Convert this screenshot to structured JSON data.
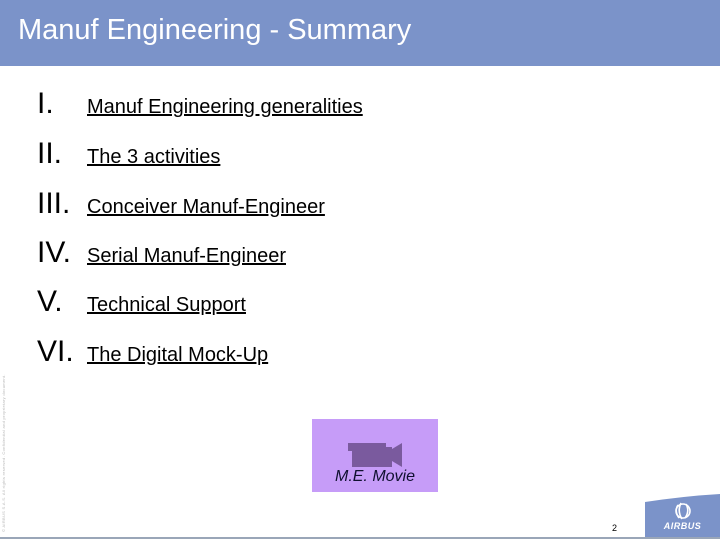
{
  "header": {
    "title": "Manuf Engineering - Summary",
    "background_color": "#7b93c9"
  },
  "copyright_notice": "© AIRBUS S.A.S. All rights reserved. Confidential and proprietary document.",
  "agenda": {
    "items": [
      {
        "numeral": "I.",
        "label": "Manuf Engineering generalities"
      },
      {
        "numeral": "II.",
        "label": "The 3 activities"
      },
      {
        "numeral": "III.",
        "label": "Conceiver Manuf-Engineer"
      },
      {
        "numeral": "IV.",
        "label": "Serial Manuf-Engineer"
      },
      {
        "numeral": "V.",
        "label": "Technical Support"
      },
      {
        "numeral": "VI.",
        "label": "The Digital Mock-Up"
      }
    ]
  },
  "movie_button": {
    "label": "M.E. Movie",
    "icon": "video-camera-icon",
    "background_color": "#c69cf8",
    "icon_color": "#7a5a9e"
  },
  "footer": {
    "page_number": "2",
    "logo_text": "AIRBUS",
    "logo_color": "#7b93c9"
  }
}
